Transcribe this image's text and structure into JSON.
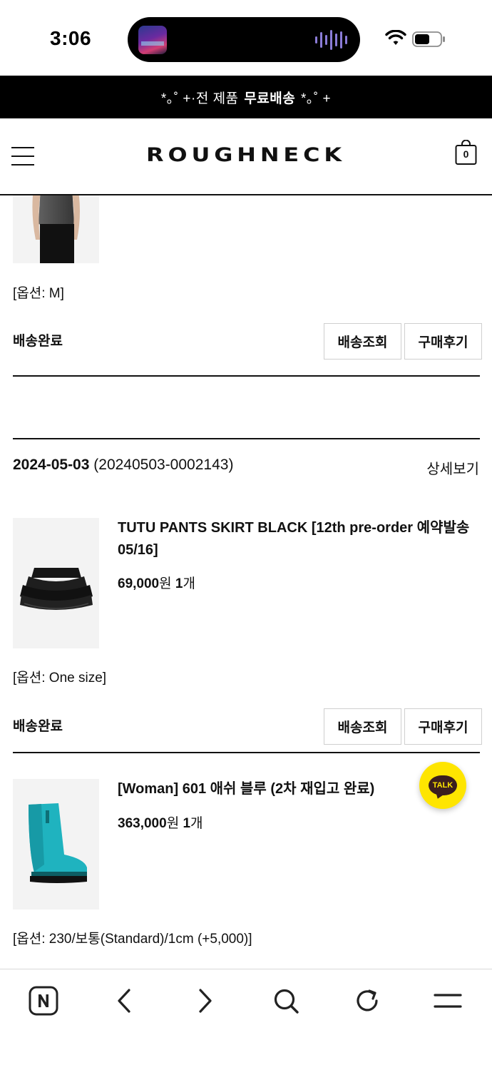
{
  "status_bar": {
    "time": "3:06",
    "icons": [
      "now-playing-artwork-icon",
      "audio-waveform-icon",
      "wifi-icon",
      "battery-icon"
    ]
  },
  "promo": {
    "prefix": "*｡˚ +·전 제품 ",
    "highlight": "무료배송",
    "suffix": " *｡˚ +"
  },
  "header": {
    "brand": "ROUGHNECK",
    "cart_count": "0",
    "icons": [
      "menu-icon",
      "cart-icon"
    ]
  },
  "orders": [
    {
      "items": [
        {
          "option": "[옵션: M]",
          "status": "배송완료",
          "buttons": [
            "배송조회",
            "구매후기"
          ]
        }
      ]
    },
    {
      "date": "2024-05-03",
      "order_number": "(20240503-0002143)",
      "detail_link": "상세보기",
      "items": [
        {
          "name": "TUTU PANTS SKIRT BLACK [12th pre-order 예약발송 05/16]",
          "price": "69,000",
          "price_unit": "원",
          "quantity": "1",
          "quantity_unit": "개",
          "option": "[옵션: One size]",
          "status": "배송완료",
          "buttons": [
            "배송조회",
            "구매후기"
          ]
        },
        {
          "name": "[Woman] 601 애쉬 블루 (2차 재입고 완료)",
          "price": "363,000",
          "price_unit": "원",
          "quantity": "1",
          "quantity_unit": "개",
          "option": "[옵션: 230/보통(Standard)/1cm (+5,000)]"
        }
      ]
    }
  ],
  "floating": {
    "kakao_label": "TALK"
  },
  "toolbar": {
    "icons": [
      "naver-home-icon",
      "back-arrow-icon",
      "forward-arrow-icon",
      "search-icon",
      "refresh-icon",
      "menu-lines-icon"
    ]
  },
  "colors": {
    "promo_bg": "#000000",
    "kakao_yellow": "#fee500",
    "boot_teal": "#1fb3bf"
  }
}
